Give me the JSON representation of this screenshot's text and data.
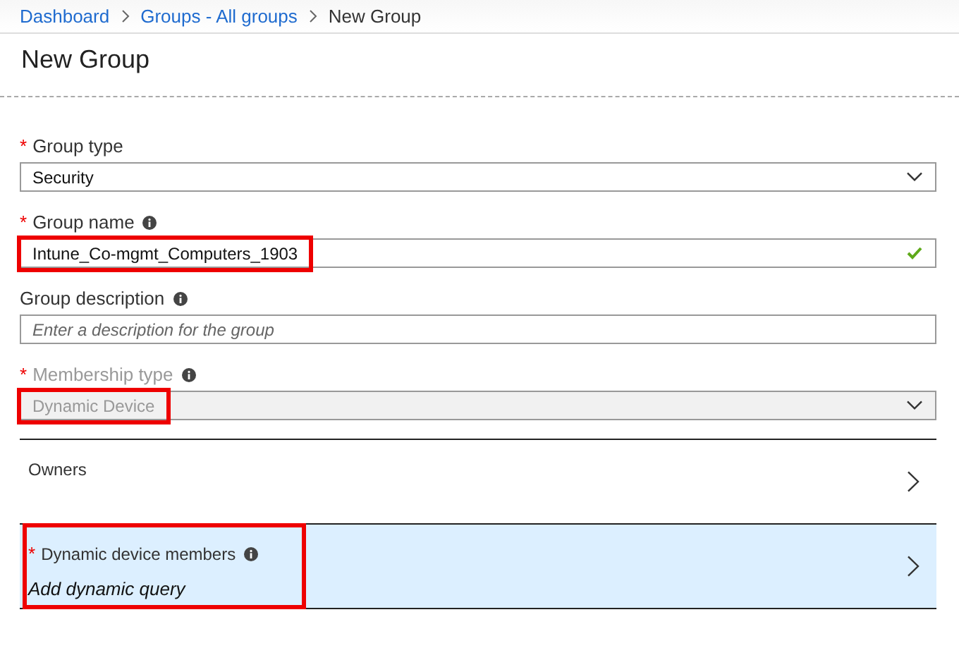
{
  "breadcrumb": [
    {
      "label": "Dashboard",
      "link": true
    },
    {
      "label": "Groups - All groups",
      "link": true
    },
    {
      "label": "New Group",
      "link": false
    }
  ],
  "title": "New Group",
  "fields": [
    {
      "kind": "select",
      "label": "Group type",
      "required_mark": "*",
      "info": false,
      "value": "Security",
      "disabled": false,
      "valid": false,
      "highlighted": false
    },
    {
      "kind": "text",
      "label": "Group name",
      "required_mark": "*",
      "info": true,
      "value": "Intune_Co-mgmt_Computers_1903",
      "disabled": false,
      "valid": true,
      "highlighted": true
    },
    {
      "kind": "text",
      "label": "Group description",
      "info": true,
      "placeholder": "Enter a description for the group",
      "disabled": false,
      "valid": false,
      "highlighted": false
    },
    {
      "kind": "select",
      "label": "Membership type",
      "required_mark": "*",
      "info": true,
      "value": "Dynamic Device",
      "disabled": true,
      "valid": false,
      "highlighted": true
    }
  ],
  "nav_items": [
    {
      "label": "Owners",
      "info": false,
      "selected": false,
      "highlighted": false
    },
    {
      "label": "Dynamic device members",
      "required_mark": "*",
      "info": true,
      "value": "Add dynamic query",
      "selected": true,
      "highlighted": true
    }
  ]
}
